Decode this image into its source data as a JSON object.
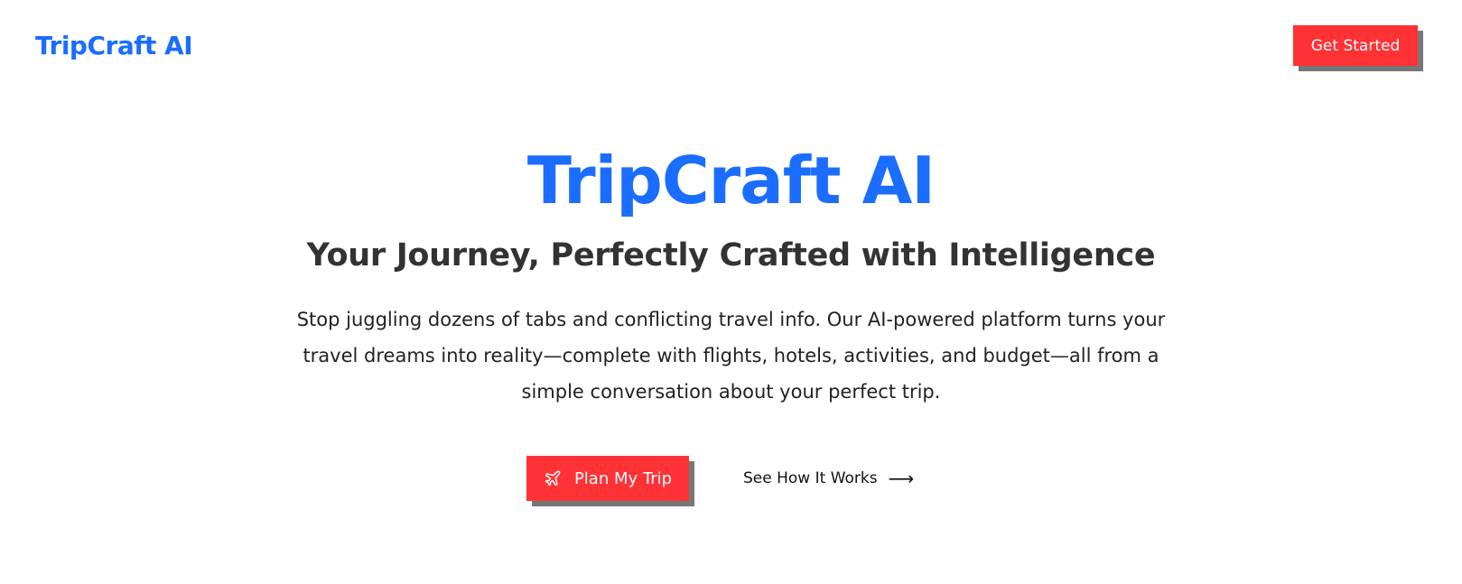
{
  "header": {
    "logo_text": "TripCraft AI",
    "cta_label": "Get Started"
  },
  "hero": {
    "title": "TripCraft AI",
    "subtitle": "Your Journey, Perfectly Crafted with Intelligence",
    "description": "Stop juggling dozens of tabs and conflicting travel info. Our AI-powered platform turns your travel dreams into reality—complete with flights, hotels, activities, and budget—all from a simple conversation about your perfect trip.",
    "primary_button": {
      "label": "Plan My Trip",
      "icon": "airplane-icon"
    },
    "secondary_link": {
      "label": "See How It Works",
      "icon": "arrow-right-icon",
      "arrow": "⟶"
    }
  },
  "colors": {
    "brand_blue": "#1a6dff",
    "accent_red": "#ff3236",
    "shadow_gray": "#777777",
    "heading_dark": "#333333"
  }
}
